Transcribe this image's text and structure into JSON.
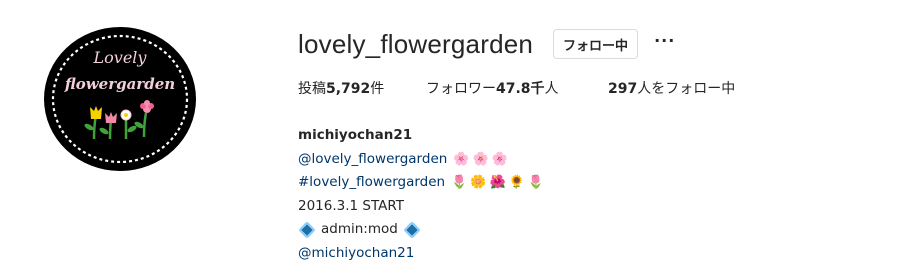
{
  "profile": {
    "username": "lovely_flowergarden",
    "follow_label": "フォロー中",
    "more_label": "···",
    "avatar": {
      "line1": "Lovely",
      "line2": "flowergarden",
      "bg_color": "#000000",
      "border_color": "#ffffff",
      "text_color": "#f2cfdc"
    }
  },
  "stats": {
    "posts_label": "投稿",
    "posts_count": "5,792",
    "posts_unit": "件",
    "followers_label": "フォロワー",
    "followers_count": "47.8千",
    "followers_unit": "人",
    "following_count": "297",
    "following_label": "人をフォロー中"
  },
  "bio": {
    "name": "michiyochan21",
    "mention1": "@lovely_flowergarden",
    "mention1_emojis": [
      "🌸",
      "🌸",
      "🌸"
    ],
    "hashtag": "#lovely_flowergarden",
    "hashtag_emojis": [
      "🌷",
      "🌼",
      "🌺",
      "🌻",
      "🌷"
    ],
    "start_text": "2016.3.1 START",
    "admin_text": "admin:mod",
    "mention2": "@michiyochan21"
  }
}
